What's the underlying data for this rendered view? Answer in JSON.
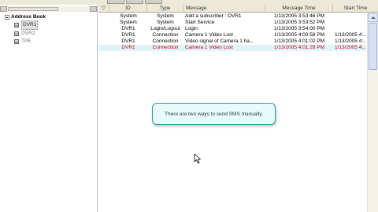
{
  "address_book": {
    "title": "Address Book",
    "items": [
      {
        "label": "DVR1",
        "selected": true
      },
      {
        "label": "DVR2",
        "selected": false
      },
      {
        "label": "TPE",
        "selected": false
      }
    ]
  },
  "table": {
    "header": {
      "sort_glyph": "▽",
      "id": "ID",
      "type": "Type",
      "message": "Message",
      "message_time": "Message Time",
      "start_time": "Start Time"
    },
    "rows": [
      {
        "id": "System",
        "type": "System",
        "message": "Add a subscriber : DVR1",
        "message_time": "1/13/2005 3:53:46 PM",
        "start_time": "",
        "style": "normal"
      },
      {
        "id": "System",
        "type": "System",
        "message": "Start Service",
        "message_time": "1/13/2005 3:53:52 PM",
        "start_time": "",
        "style": "normal"
      },
      {
        "id": "DVR1",
        "type": "Login/Logout",
        "message": "Login",
        "message_time": "1/13/2005 3:54:00 PM",
        "start_time": "",
        "style": "normal"
      },
      {
        "id": "DVR1",
        "type": "Connection",
        "message": "Camera 1 Video Lost",
        "message_time": "1/13/2005 4:00:58 PM",
        "start_time": "1/13/2005 4:...",
        "style": "normal"
      },
      {
        "id": "DVR1",
        "type": "Connection",
        "message": "Video signal of Camera 1 ha...",
        "message_time": "1/13/2005 4:01:02 PM",
        "start_time": "1/13/2005 4:...",
        "style": "normal"
      },
      {
        "id": "DVR1",
        "type": "Connection",
        "message": "Camera 1 Video Lost",
        "message_time": "1/13/2005 4:01:28 PM",
        "start_time": "1/13/2005 4:...",
        "style": "red"
      }
    ]
  },
  "tooltip": {
    "text": "There are two ways to send SMS manually."
  },
  "colors": {
    "alarm_text": "#c40000",
    "tooltip_border": "#2aa0a6",
    "row_highlight": "#dff3fb"
  }
}
